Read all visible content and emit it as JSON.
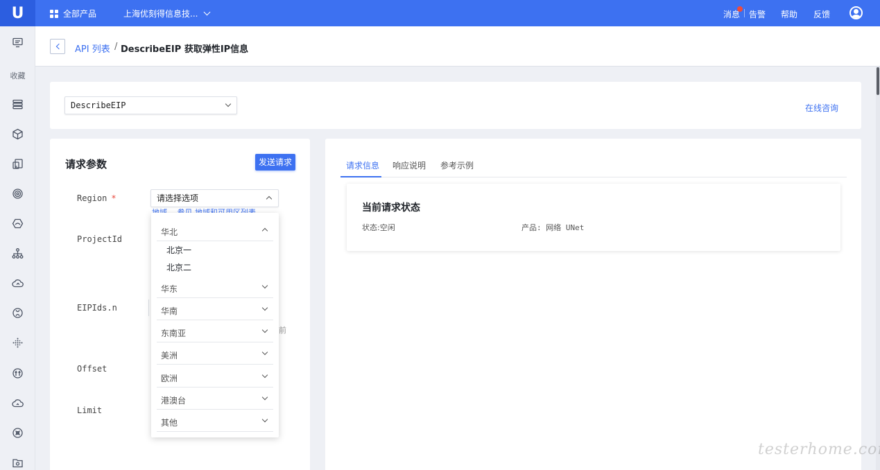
{
  "topbar": {
    "logo_letter": "U",
    "all_products": "全部产品",
    "company": "上海优刻得信息技...",
    "messages": "消息",
    "alerts": "告警",
    "help": "帮助",
    "feedback": "反馈"
  },
  "sidebar": {
    "favorites_label": "收藏"
  },
  "breadcrumb": {
    "parent": "API 列表",
    "separator": "/",
    "current": "DescribeEIP 获取弹性IP信息"
  },
  "api_selector": {
    "value": "DescribeEIP",
    "consult": "在线咨询"
  },
  "request_params": {
    "title": "请求参数",
    "send_button": "发送请求",
    "params": [
      {
        "name": "Region",
        "required": "*"
      },
      {
        "name": "ProjectId"
      },
      {
        "name": "EIPIds.n"
      },
      {
        "name": "Offset"
      },
      {
        "name": "Limit"
      }
    ],
    "region_placeholder": "请选择选项",
    "region_hint": "地域， 参见 地域和可用区列表",
    "hint_fragment": "前"
  },
  "region_dropdown": {
    "groups": [
      {
        "label": "华北",
        "expanded": true,
        "options": [
          "北京一",
          "北京二"
        ]
      },
      {
        "label": "华东"
      },
      {
        "label": "华南"
      },
      {
        "label": "东南亚"
      },
      {
        "label": "美洲"
      },
      {
        "label": "欧洲"
      },
      {
        "label": "港澳台"
      },
      {
        "label": "其他"
      }
    ]
  },
  "right_panel": {
    "tabs": [
      "请求信息",
      "响应说明",
      "参考示例"
    ],
    "active_tab": 0,
    "status_title": "当前请求状态",
    "status_label": "状态:空闲",
    "product_label": "产品: 网络 UNet"
  },
  "watermark": "testerhome.com",
  "colors": {
    "accent": "#3d71f1",
    "required": "#e8463a",
    "notification": "#f04b3d"
  }
}
